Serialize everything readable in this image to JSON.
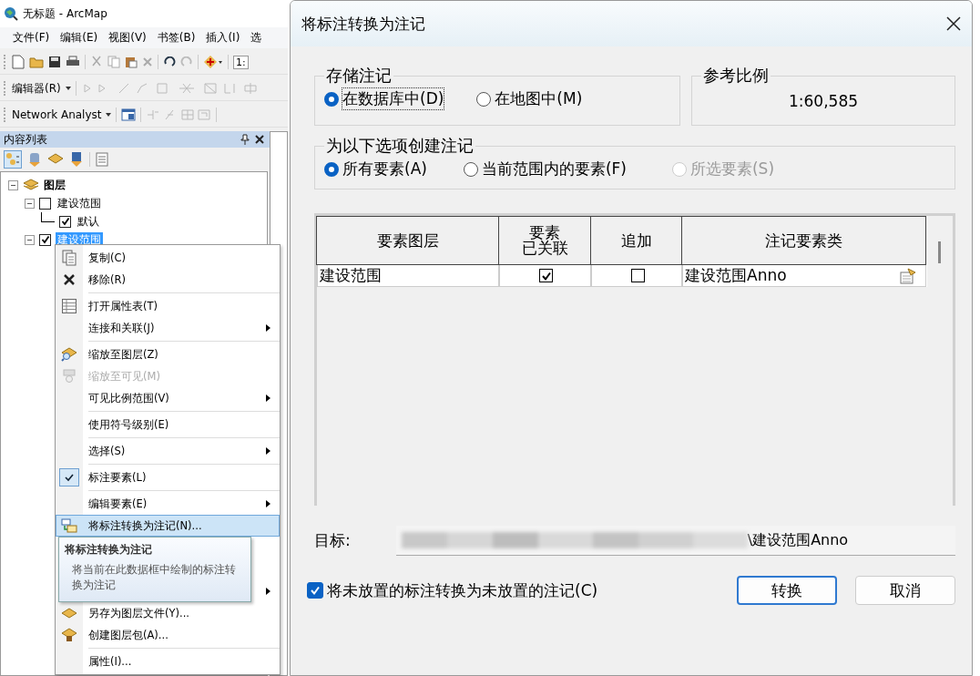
{
  "app_window": {
    "title": "无标题 - ArcMap",
    "menu": [
      "文件(F)",
      "编辑(E)",
      "视图(V)",
      "书签(B)",
      "插入(I)",
      "选"
    ],
    "scale_field": "1:",
    "editor_menu": "编辑器(R)",
    "network_menu": "Network Analyst"
  },
  "toc": {
    "title": "内容列表",
    "tree": [
      {
        "label": "图层",
        "expanded": true,
        "children": [
          {
            "label": "建设范围",
            "checked": false,
            "expanded": true,
            "selected": false,
            "children": [
              {
                "label": "默认",
                "checked": true
              }
            ]
          },
          {
            "label": "建设范围",
            "checked": true,
            "expanded": true,
            "selected": true
          }
        ]
      }
    ]
  },
  "context_menu": {
    "items": [
      {
        "kind": "item",
        "label": "复制(C)",
        "submenu": false,
        "disabled": false,
        "checked": false,
        "selected": false
      },
      {
        "kind": "item",
        "label": "移除(R)",
        "submenu": false,
        "disabled": false,
        "checked": false,
        "selected": false
      },
      {
        "kind": "separator"
      },
      {
        "kind": "item",
        "label": "打开属性表(T)",
        "submenu": false,
        "disabled": false,
        "checked": false,
        "selected": false
      },
      {
        "kind": "item",
        "label": "连接和关联(J)",
        "submenu": true,
        "disabled": false,
        "checked": false,
        "selected": false
      },
      {
        "kind": "separator"
      },
      {
        "kind": "item",
        "label": "缩放至图层(Z)",
        "submenu": false,
        "disabled": false,
        "checked": false,
        "selected": false
      },
      {
        "kind": "item",
        "label": "缩放至可见(M)",
        "submenu": false,
        "disabled": true,
        "checked": false,
        "selected": false
      },
      {
        "kind": "item",
        "label": "可见比例范围(V)",
        "submenu": true,
        "disabled": false,
        "checked": false,
        "selected": false
      },
      {
        "kind": "separator"
      },
      {
        "kind": "item",
        "label": "使用符号级别(E)",
        "submenu": false,
        "disabled": false,
        "checked": false,
        "selected": false
      },
      {
        "kind": "separator"
      },
      {
        "kind": "item",
        "label": "选择(S)",
        "submenu": true,
        "disabled": false,
        "checked": false,
        "selected": false
      },
      {
        "kind": "separator"
      },
      {
        "kind": "item",
        "label": "标注要素(L)",
        "submenu": false,
        "disabled": false,
        "checked": true,
        "selected": false
      },
      {
        "kind": "separator"
      },
      {
        "kind": "item",
        "label": "编辑要素(E)",
        "submenu": true,
        "disabled": false,
        "checked": false,
        "selected": false
      },
      {
        "kind": "item",
        "label": "将标注转换为注记(N)...",
        "submenu": false,
        "disabled": false,
        "checked": false,
        "selected": true
      },
      {
        "kind": "hidden",
        "submenu": false
      },
      {
        "kind": "hidden",
        "submenu": false
      },
      {
        "kind": "hidden",
        "submenu": true
      },
      {
        "kind": "item",
        "label": "另存为图层文件(Y)...",
        "submenu": false,
        "disabled": false,
        "checked": false,
        "selected": false
      },
      {
        "kind": "item",
        "label": "创建图层包(A)...",
        "submenu": false,
        "disabled": false,
        "checked": false,
        "selected": false
      },
      {
        "kind": "separator"
      },
      {
        "kind": "item",
        "label": "属性(I)...",
        "submenu": false,
        "disabled": false,
        "checked": false,
        "selected": false
      }
    ]
  },
  "tooltip": {
    "title": "将标注转换为注记",
    "text": "将当前在此数据框中绘制的标注转换为注记"
  },
  "dialog": {
    "title": "将标注转换为注记",
    "store_group": {
      "title": "存储注记",
      "options": [
        {
          "label": "在数据库中(D)",
          "selected": true,
          "focused": true
        },
        {
          "label": "在地图中(M)",
          "selected": false,
          "focused": false
        }
      ]
    },
    "reference_scale": {
      "title": "参考比例",
      "value": "1:60,585"
    },
    "create_group": {
      "title": "为以下选项创建注记",
      "options": [
        {
          "label": "所有要素(A)",
          "selected": true,
          "disabled": false
        },
        {
          "label": "当前范围内的要素(F)",
          "selected": false,
          "disabled": false
        },
        {
          "label": "所选要素(S)",
          "selected": false,
          "disabled": true
        }
      ]
    },
    "table": {
      "columns": [
        "要素图层",
        "要素已关联",
        "追加",
        "注记要素类"
      ],
      "rows": [
        {
          "layer": "建设范围",
          "feature_linked": true,
          "append": false,
          "annotation_class": "建设范围Anno"
        }
      ]
    },
    "target": {
      "label": "目标:",
      "value": "\\建设范围Anno"
    },
    "unplaced": {
      "label": "将未放置的标注转换为未放置的注记(C)",
      "checked": true
    },
    "buttons": [
      {
        "label": "转换",
        "default": true
      },
      {
        "label": "取消",
        "default": false
      }
    ]
  }
}
